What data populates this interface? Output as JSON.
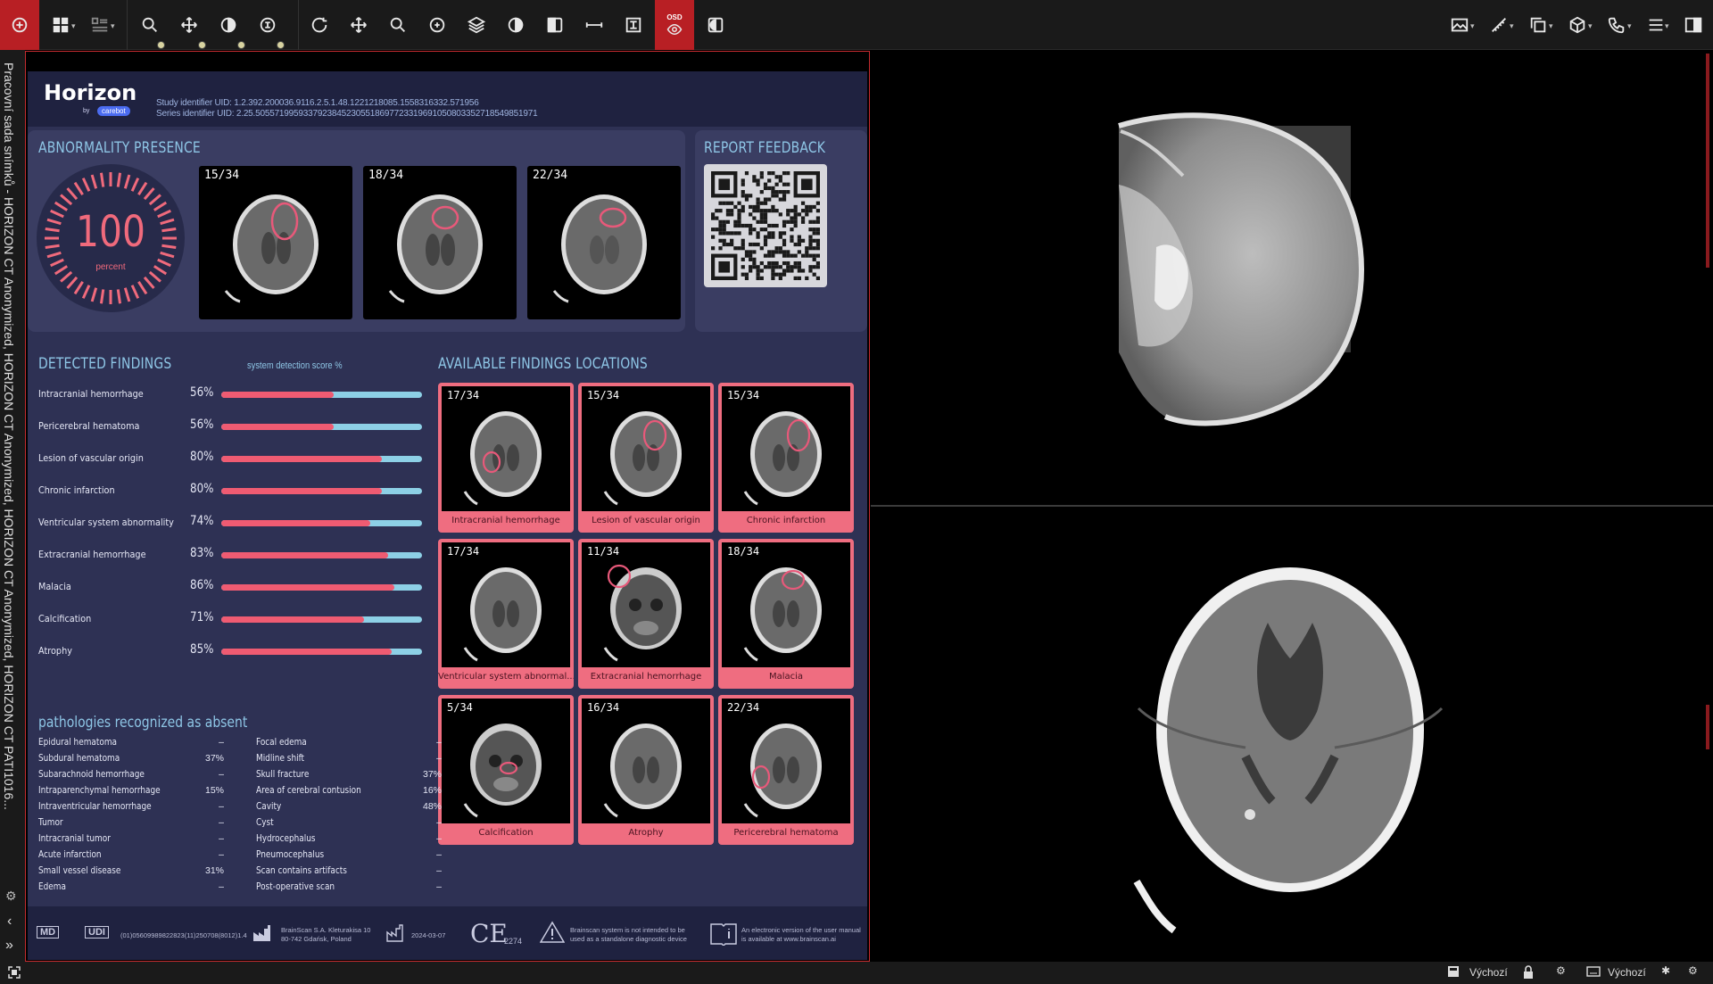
{
  "toolbar": {
    "left_tools": [
      "add-icon",
      "layout-icon",
      "list-layout-icon",
      "zoom-icon",
      "pan-icon",
      "contrast-icon",
      "bone-window-icon",
      "rotate-icon",
      "move-icon",
      "zoom-alt-icon",
      "window-level-icon",
      "layers-icon",
      "invert-icon",
      "mask-icon",
      "measure-line-icon",
      "ruler-icon",
      "osd-eye-icon",
      "overlay-icon"
    ],
    "osd_label": "OSD",
    "right_tools": [
      "image-icon",
      "ruler-pen-icon",
      "copy-icon",
      "cube-icon",
      "phone-icon",
      "menu-icon",
      "panel-icon"
    ]
  },
  "sidebar": {
    "vertical_title": "Pracovní sada snímků - HORIZON CT Anonymized, HORIZON CT Anonymized, HORIZON CT Anonymized, HORIZON CT PATI1016..."
  },
  "report": {
    "logo": "Horizon",
    "logo_by": "by",
    "logo_brand": "carebot",
    "study_uid": "Study identifier UID: 1.2.392.200036.9116.2.5.1.48.1221218085.1558316332.571956",
    "series_uid": "Series identifier UID: 2.25.50557199593379238452305518697723319691050803352718549851971",
    "abnormality_title": "ABNORMALITY PRESENCE",
    "gauge_value": "100",
    "gauge_unit": "percent",
    "abnormality_slices": [
      "15/34",
      "18/34",
      "22/34"
    ],
    "feedback_title": "REPORT FEEDBACK",
    "findings_title": "DETECTED FINDINGS",
    "score_header": "system detection score %",
    "findings": [
      {
        "name": "Intracranial hemorrhage",
        "pct": "56%",
        "value": 0.56
      },
      {
        "name": "Pericerebral hematoma",
        "pct": "56%",
        "value": 0.56
      },
      {
        "name": "Lesion of vascular origin",
        "pct": "80%",
        "value": 0.8
      },
      {
        "name": "Chronic infarction",
        "pct": "80%",
        "value": 0.8
      },
      {
        "name": "Ventricular system abnormality",
        "pct": "74%",
        "value": 0.74
      },
      {
        "name": "Extracranial hemorrhage",
        "pct": "83%",
        "value": 0.83
      },
      {
        "name": "Malacia",
        "pct": "86%",
        "value": 0.86
      },
      {
        "name": "Calcification",
        "pct": "71%",
        "value": 0.71
      },
      {
        "name": "Atrophy",
        "pct": "85%",
        "value": 0.85
      }
    ],
    "locations_title": "AVAILABLE FINDINGS LOCATIONS",
    "locations": [
      {
        "slice": "17/34",
        "label": "Intracranial hemorrhage"
      },
      {
        "slice": "15/34",
        "label": "Lesion of vascular origin"
      },
      {
        "slice": "15/34",
        "label": "Chronic infarction"
      },
      {
        "slice": "17/34",
        "label": "Ventricular system abnormal..."
      },
      {
        "slice": "11/34",
        "label": "Extracranial hemorrhage"
      },
      {
        "slice": "18/34",
        "label": "Malacia"
      },
      {
        "slice": "5/34",
        "label": "Calcification"
      },
      {
        "slice": "16/34",
        "label": "Atrophy"
      },
      {
        "slice": "22/34",
        "label": "Pericerebral hematoma"
      }
    ],
    "absent_title": "pathologies recognized as absent",
    "absent_left": [
      {
        "name": "Epidural hematoma",
        "val": "–"
      },
      {
        "name": "Subdural hematoma",
        "val": "37%"
      },
      {
        "name": "Subarachnoid hemorrhage",
        "val": "–"
      },
      {
        "name": "Intraparenchymal hemorrhage",
        "val": "15%"
      },
      {
        "name": "Intraventricular hemorrhage",
        "val": "–"
      },
      {
        "name": "Tumor",
        "val": "–"
      },
      {
        "name": "Intracranial tumor",
        "val": "–"
      },
      {
        "name": "Acute infarction",
        "val": "–"
      },
      {
        "name": "Small vessel disease",
        "val": "31%"
      },
      {
        "name": "Edema",
        "val": "–"
      }
    ],
    "absent_right": [
      {
        "name": "Focal edema",
        "val": "–"
      },
      {
        "name": "Midline shift",
        "val": "–"
      },
      {
        "name": "Skull fracture",
        "val": "37%"
      },
      {
        "name": "Area of cerebral contusion",
        "val": "16%"
      },
      {
        "name": "Cavity",
        "val": "48%"
      },
      {
        "name": "Cyst",
        "val": "–"
      },
      {
        "name": "Hydrocephalus",
        "val": "–"
      },
      {
        "name": "Pneumocephalus",
        "val": "–"
      },
      {
        "name": "Scan contains artifacts",
        "val": "–"
      },
      {
        "name": "Post-operative scan",
        "val": "–"
      }
    ],
    "footer": {
      "md": "MD",
      "udi": "UDI",
      "udi_code": "(01)05609989822823(11)250708(8012)1.4",
      "manufacturer_line1": "BrainScan S.A. Kleturakisa 10",
      "manufacturer_line2": "80-742 Gdańsk, Poland",
      "date": "2024-03-07",
      "ce": "CE",
      "ce_num": "2274",
      "warning_line1": "Brainscan system is not intended to be",
      "warning_line2": "used as a standalone diagnostic device",
      "manual_line1": "An electronic version of the user manual",
      "manual_line2": "is available at www.brainscan.ai"
    }
  },
  "statusbar": {
    "left_icon": "fullscreen-icon",
    "layout_label_1": "Výchozí",
    "layout_label_2": "Výchozí"
  },
  "colors": {
    "accent_red": "#b81f24",
    "report_bg": "#2e3154",
    "finding_bar": "#ef5b72",
    "finding_bar_bg": "#8dd0e6",
    "title_blue": "#8ec6e6"
  }
}
